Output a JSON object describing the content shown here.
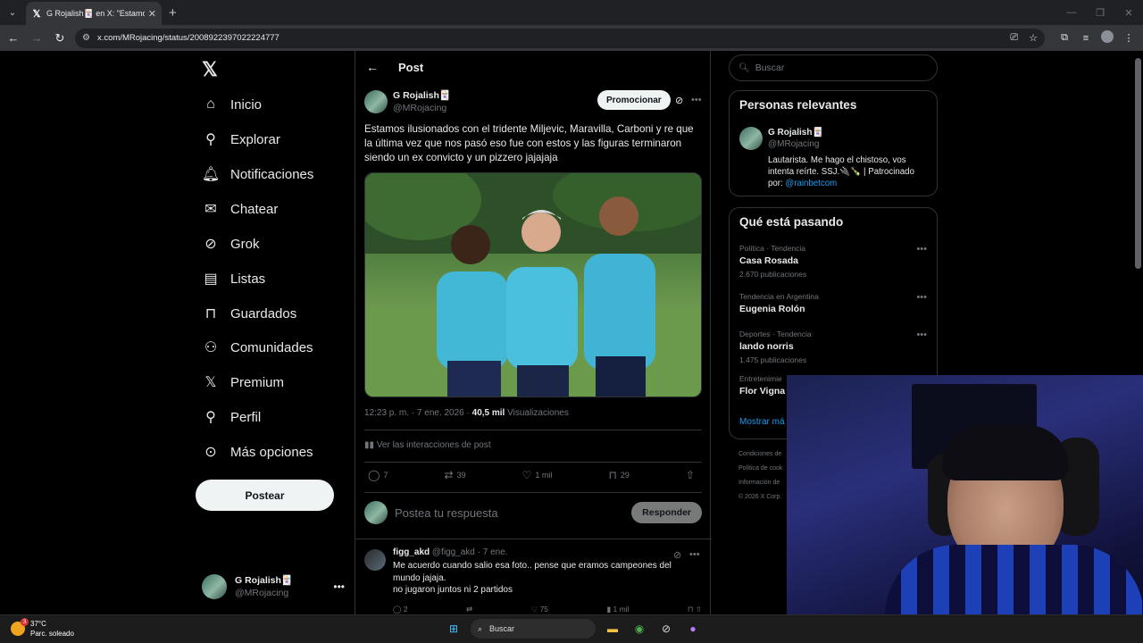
{
  "browser": {
    "tab_title": "G Rojalish🃏 en X: \"Estamos ilusi",
    "url": "x.com/MRojacing/status/2008922397022224777"
  },
  "nav": {
    "items": [
      {
        "label": "Inicio",
        "icon": "home-icon"
      },
      {
        "label": "Explorar",
        "icon": "search-icon"
      },
      {
        "label": "Notificaciones",
        "icon": "bell-icon"
      },
      {
        "label": "Chatear",
        "icon": "mail-icon"
      },
      {
        "label": "Grok",
        "icon": "grok-icon"
      },
      {
        "label": "Listas",
        "icon": "list-icon"
      },
      {
        "label": "Guardados",
        "icon": "bookmark-icon"
      },
      {
        "label": "Comunidades",
        "icon": "people-icon"
      },
      {
        "label": "Premium",
        "icon": "x-icon"
      },
      {
        "label": "Perfil",
        "icon": "person-icon"
      },
      {
        "label": "Más opciones",
        "icon": "more-circle-icon"
      }
    ],
    "post_button": "Postear",
    "me": {
      "name": "G Rojalish🃏",
      "handle": "@MRojacing"
    }
  },
  "post": {
    "header": "Post",
    "author_name": "G Rojalish🃏",
    "author_handle": "@MRojacing",
    "promote": "Promocionar",
    "text": "Estamos ilusionados con el tridente Miljevic, Maravilla, Carboni y re que la última vez que nos pasó eso fue con estos y las figuras terminaron siendo un ex convicto y un pizzero jajajaja",
    "time": "12:23 p. m. · 7 ene. 2026 ·",
    "views_count": "40,5 mil",
    "views_label": "Visualizaciones",
    "interactions": "Ver las interacciones de post",
    "replies": "7",
    "reposts": "39",
    "likes": "1 mil",
    "bookmarks": "29",
    "reply_placeholder": "Postea tu respuesta",
    "reply_button": "Responder"
  },
  "reply": {
    "name": "figg_akd",
    "handle": "@figg_akd · 7 ene.",
    "text": "Me acuerdo cuando salio esa foto.. pense que eramos campeones del mundo jajaja.\nno jugaron juntos ni 2 partidos",
    "replies": "2",
    "likes": "75",
    "views": "1 mil"
  },
  "sidebar": {
    "search_placeholder": "Buscar",
    "relevant_title": "Personas relevantes",
    "rel_name": "G Rojalish🃏",
    "rel_handle": "@MRojacing",
    "rel_bio": "Lautarista. Me hago el chistoso, vos intenta reírte. SSJ.🔌🍾 | Patrocinado por: ",
    "rel_link": "@rainbetcom",
    "trends_title": "Qué está pasando",
    "trends": [
      {
        "cat": "Política · Tendencia",
        "name": "Casa Rosada",
        "count": "2.670 publicaciones"
      },
      {
        "cat": "Tendencia en Argentina",
        "name": "Eugenia Rolón",
        "count": ""
      },
      {
        "cat": "Deportes · Tendencia",
        "name": "lando norris",
        "count": "1.475 publicaciones"
      },
      {
        "cat": "Entretenimie",
        "name": "Flor Vigna",
        "count": ""
      }
    ],
    "show_more": "Mostrar má",
    "footer": [
      "Condiciones de",
      "Política de cook",
      "Información de",
      "© 2026 X Corp."
    ]
  },
  "taskbar": {
    "temp": "37°C",
    "weather": "Parc. soleado",
    "search": "Buscar",
    "notif_count": "3"
  }
}
